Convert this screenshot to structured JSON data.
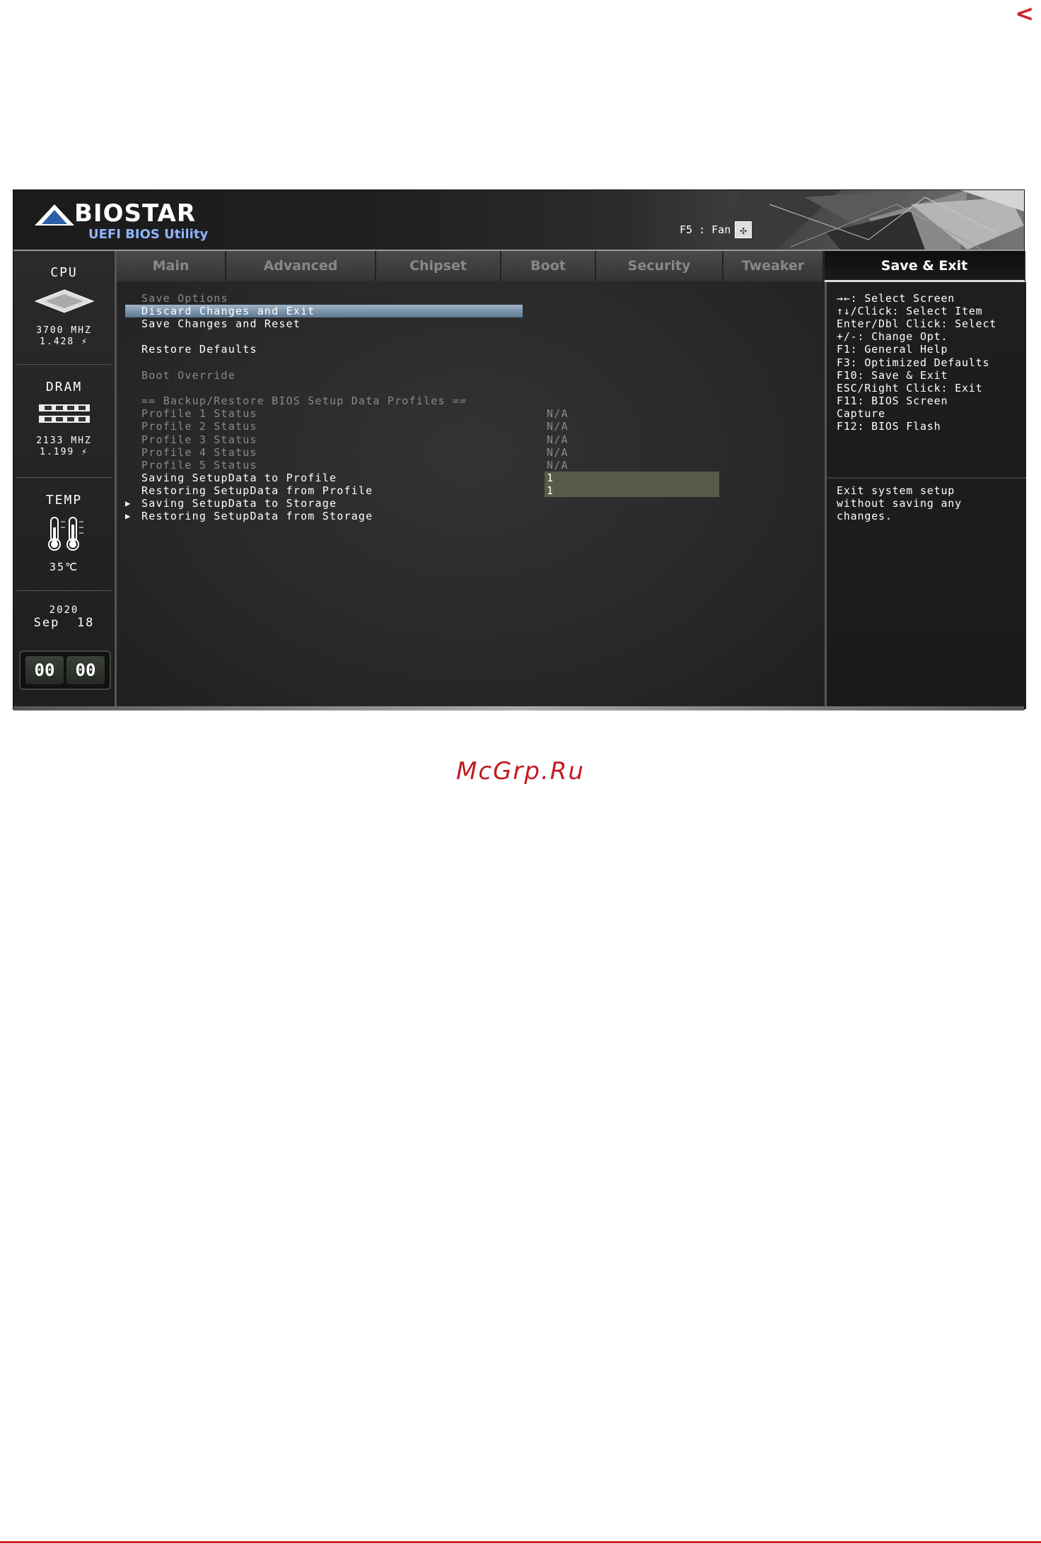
{
  "page": {
    "corner_mark": "<",
    "watermark": "McGrp.Ru"
  },
  "header": {
    "brand": "BIOSTAR",
    "subtitle": "UEFI BIOS Utility",
    "fan_hint": "F5 : Fan"
  },
  "sidebar": {
    "cpu": {
      "title": "CPU",
      "freq": "3700 MHZ",
      "volt": "1.428 ⚡"
    },
    "dram": {
      "title": "DRAM",
      "freq": "2133 MHZ",
      "volt": "1.199 ⚡"
    },
    "temp": {
      "title": "TEMP",
      "value": "35℃"
    },
    "date": {
      "year": "2020",
      "day": "Sep  18"
    },
    "clock": {
      "hours": "00",
      "minutes": "00"
    }
  },
  "tabs": [
    "Main",
    "Advanced",
    "Chipset",
    "Boot",
    "Security",
    "Tweaker",
    "Save & Exit"
  ],
  "active_tab": "Save & Exit",
  "menu": [
    {
      "label": "Save Options",
      "style": "dim"
    },
    {
      "label": "Discard Changes and Exit",
      "style": "selected"
    },
    {
      "label": "Save Changes and Reset",
      "style": "bright"
    },
    {
      "label": "Restore Defaults",
      "style": "bright"
    },
    {
      "label": "Boot Override",
      "style": "dim"
    },
    {
      "label": "== Backup/Restore BIOS Setup Data Profiles ==",
      "style": "dim"
    },
    {
      "label": "Profile 1 Status",
      "value": "N/A",
      "style": "dim"
    },
    {
      "label": "Profile 2 Status",
      "value": "N/A",
      "style": "dim"
    },
    {
      "label": "Profile 3 Status",
      "value": "N/A",
      "style": "dim"
    },
    {
      "label": "Profile 4 Status",
      "value": "N/A",
      "style": "dim"
    },
    {
      "label": "Profile 5 Status",
      "value": "N/A",
      "style": "dim"
    },
    {
      "label": "Saving SetupData to Profile",
      "value": "1",
      "style": "bright"
    },
    {
      "label": "Restoring SetupData from Profile",
      "value": "1",
      "style": "bright"
    },
    {
      "label": "Saving SetupData to Storage",
      "style": "bright",
      "submenu": true
    },
    {
      "label": "Restoring SetupData from Storage",
      "style": "bright",
      "submenu": true
    }
  ],
  "help_keys": [
    "→←: Select Screen",
    "↑↓/Click: Select Item",
    "Enter/Dbl Click: Select",
    "+/-: Change Opt.",
    "F1: General Help",
    "F3: Optimized Defaults",
    "F10: Save & Exit",
    "ESC/Right Click: Exit",
    "F11: BIOS Screen",
    "Capture",
    "F12: BIOS Flash"
  ],
  "help_description": [
    "Exit system setup",
    "without saving any",
    "changes."
  ]
}
